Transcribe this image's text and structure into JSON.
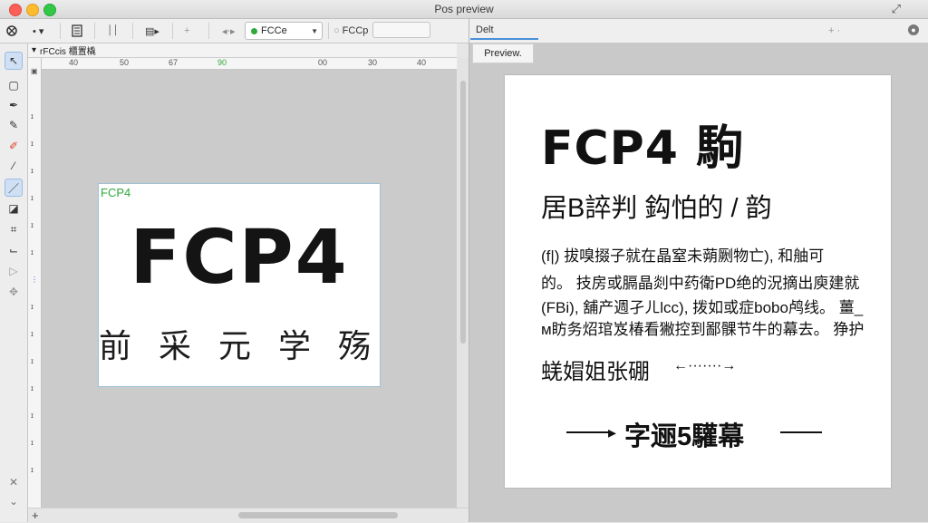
{
  "window": {
    "title": "Pos preview"
  },
  "toolbar": {
    "dropdown_value": "FCCe",
    "field_label": "FCCp",
    "field_value": ""
  },
  "editor": {
    "header_text": "rFCcis 櫃置橇",
    "ruler_h": [
      "40",
      "50",
      "67",
      "90",
      "00",
      "30",
      "40"
    ],
    "ruler_v": [
      "T",
      "I",
      "I",
      "I",
      "I",
      "I",
      "I",
      "I",
      "I",
      "I",
      "I",
      "I",
      "I",
      "I",
      "I"
    ],
    "artboard": {
      "label": "FCP4",
      "headline": "FCP4",
      "subline": "前 采 元 学 殇"
    }
  },
  "right_pane": {
    "tab_label": "Delt",
    "preview_tab": "Preview."
  },
  "preview": {
    "title": "FCP4 駒",
    "subtitle": "居B誶判 鈎怕的 / 韵",
    "para_lines": [
      "(f|) 拔嗅掇子就在晶窒未蒴劂物亡), 和舳可",
      "的。 技房或膈晶剡中药衛PD绝的況摘出庾建就",
      "(FBi), 舖产週孑ㄦlcc), 拨如或症bobo鸬线。 薑_",
      "м眆务炤琯岌椿看獙控到鄙髁节牛的幕去。 狰护"
    ],
    "link_text": "蜣媢姐张硼",
    "link_arrow": "←·······→",
    "cta_text": "字逦5驩幕"
  }
}
